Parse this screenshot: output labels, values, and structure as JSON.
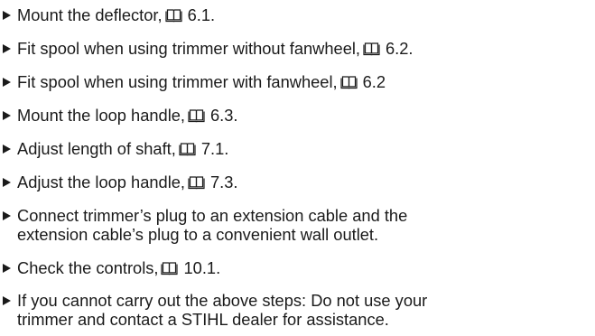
{
  "steps": [
    {
      "text": "Mount the deflector,",
      "icon": "book-icon",
      "ref": "6.1."
    },
    {
      "text": "Fit spool when using trimmer without fanwheel,",
      "icon": "book-icon",
      "ref": "6.2."
    },
    {
      "text": "Fit spool when using trimmer with fanwheel,",
      "icon": "book-icon",
      "ref": "6.2"
    },
    {
      "text": "Mount the loop handle,",
      "icon": "book-icon",
      "ref": "6.3."
    },
    {
      "text": "Adjust length of shaft,",
      "icon": "book-icon",
      "ref": "7.1."
    },
    {
      "text": "Adjust the loop handle,",
      "icon": "book-icon",
      "ref": "7.3."
    },
    {
      "line1": "Connect trimmer’s plug to an extension cable and the",
      "line2": "extension cable’s plug to a convenient wall outlet."
    },
    {
      "text": "Check the controls,",
      "icon": "book-icon",
      "ref": "10.1."
    },
    {
      "line1": "If you cannot carry out the above steps: Do not use your",
      "line2": "trimmer and contact a STIHL dealer for assistance."
    }
  ]
}
